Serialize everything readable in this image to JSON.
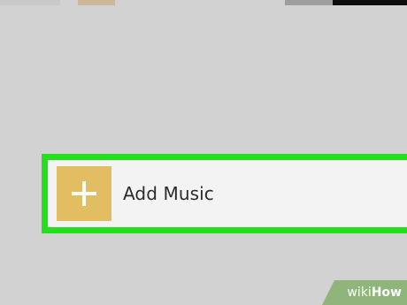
{
  "add_music_button": {
    "label": "Add Music",
    "icon": "plus-icon"
  },
  "colors": {
    "background": "#d2d2d2",
    "highlight_border": "#22e01a",
    "row_background": "#f3f3f3",
    "plus_tile": "#e2bd62"
  },
  "watermark": {
    "wiki": "wiki",
    "how": "How"
  }
}
